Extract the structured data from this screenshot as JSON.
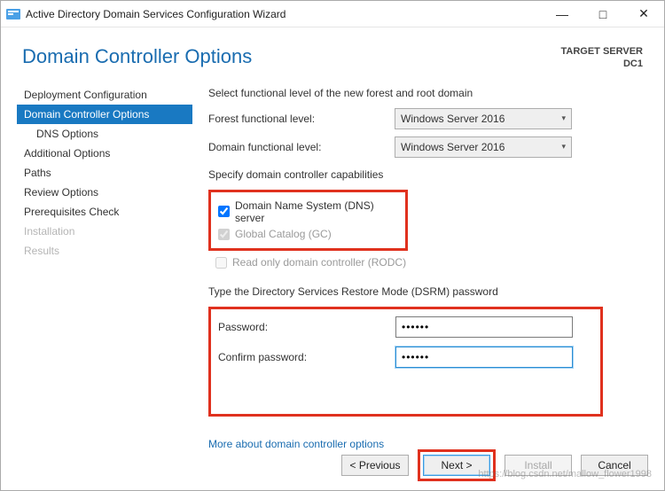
{
  "window": {
    "title": "Active Directory Domain Services Configuration Wizard"
  },
  "header": {
    "page_title": "Domain Controller Options",
    "target_label": "TARGET SERVER",
    "target_name": "DC1"
  },
  "sidebar": {
    "items": [
      {
        "label": "Deployment Configuration"
      },
      {
        "label": "Domain Controller Options"
      },
      {
        "label": "DNS Options"
      },
      {
        "label": "Additional Options"
      },
      {
        "label": "Paths"
      },
      {
        "label": "Review Options"
      },
      {
        "label": "Prerequisites Check"
      },
      {
        "label": "Installation"
      },
      {
        "label": "Results"
      }
    ]
  },
  "content": {
    "functional_intro": "Select functional level of the new forest and root domain",
    "forest_level_label": "Forest functional level:",
    "forest_level_value": "Windows Server 2016",
    "domain_level_label": "Domain functional level:",
    "domain_level_value": "Windows Server 2016",
    "capabilities_label": "Specify domain controller capabilities",
    "cb_dns": "Domain Name System (DNS) server",
    "cb_gc": "Global Catalog (GC)",
    "cb_rodc": "Read only domain controller (RODC)",
    "dsrm_label": "Type the Directory Services Restore Mode (DSRM) password",
    "password_label": "Password:",
    "password_value": "••••••",
    "confirm_label": "Confirm password:",
    "confirm_value": "••••••",
    "more_link": "More about domain controller options"
  },
  "footer": {
    "previous": "< Previous",
    "next": "Next >",
    "install": "Install",
    "cancel": "Cancel"
  },
  "watermark": "https://blog.csdn.net/mallow_flower1998"
}
